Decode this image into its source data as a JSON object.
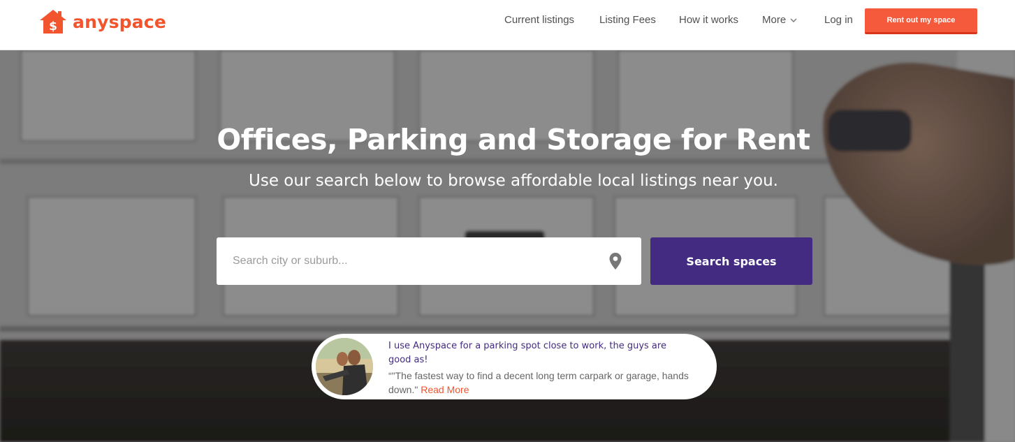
{
  "brand": {
    "name": "anyspace",
    "color": "#f2542d"
  },
  "nav": {
    "current_listings": "Current listings",
    "listing_fees": "Listing Fees",
    "how_it_works": "How it works",
    "more": "More",
    "log_in": "Log in",
    "rent_out": "Rent out my space"
  },
  "hero": {
    "title": "Offices, Parking and Storage for Rent",
    "subtitle": "Use our search below to browse affordable local listings near you."
  },
  "search": {
    "placeholder": "Search city or suburb...",
    "value": "",
    "button_label": "Search spaces",
    "button_color": "#422b80"
  },
  "testimonial": {
    "quote": "I use Anyspace for a parking spot close to work, the guys are good as!",
    "body": "“\"The fastest way to find a decent long term carpark or garage, hands down.\"",
    "read_more": "Read More"
  },
  "icons": {
    "logo": "house-dollar-icon",
    "more": "chevron-down-icon",
    "location": "map-pin-icon"
  }
}
